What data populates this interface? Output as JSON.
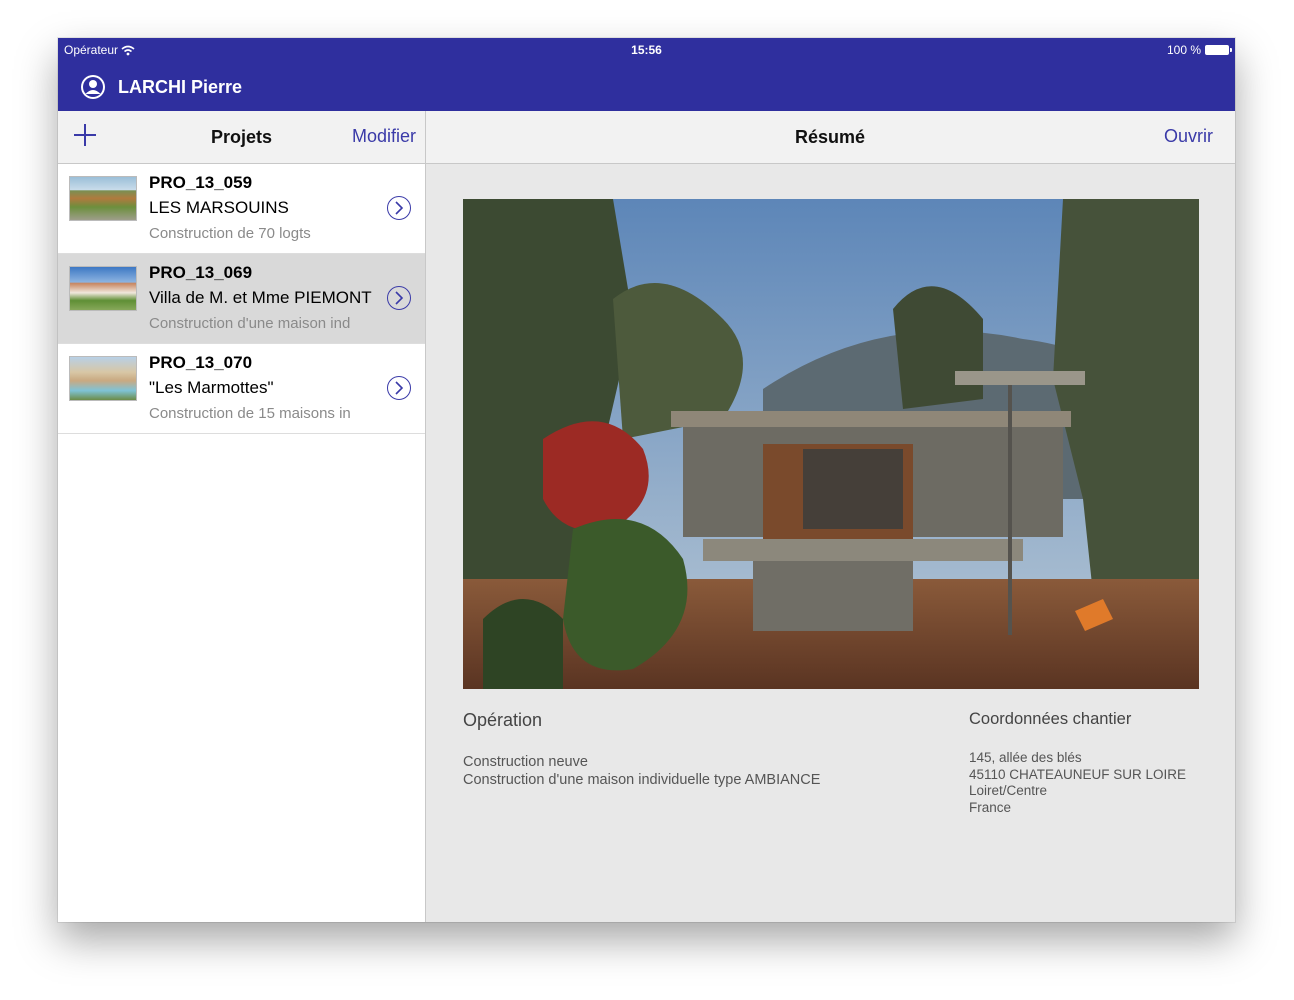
{
  "status_bar": {
    "carrier": "Opérateur",
    "time": "15:56",
    "battery": "100 %"
  },
  "header": {
    "user_name": "LARCHI Pierre"
  },
  "left_nav": {
    "title": "Projets",
    "edit_label": "Modifier"
  },
  "right_nav": {
    "title": "Résumé",
    "open_label": "Ouvrir"
  },
  "projects": [
    {
      "code": "PRO_13_059",
      "name": "LES MARSOUINS",
      "desc": "Construction de 70 logts"
    },
    {
      "code": "PRO_13_069",
      "name": "Villa de M. et Mme PIEMONT",
      "desc": "Construction d'une maison ind"
    },
    {
      "code": "PRO_13_070",
      "name": " \"Les Marmottes\"",
      "desc": "Construction de 15 maisons in"
    }
  ],
  "selected_project_index": 1,
  "operation": {
    "title": "Opération",
    "lines": [
      "Construction neuve",
      "Construction d'une maison individuelle type AMBIANCE"
    ]
  },
  "site": {
    "title": "Coordonnées chantier",
    "lines": [
      "145, allée des blés",
      "45110 CHATEAUNEUF SUR LOIRE",
      "Loiret/Centre",
      "France"
    ]
  },
  "colors": {
    "header_bg": "#2f2f9e",
    "accent": "#3a3aa8",
    "selected_row": "#d9d9d9"
  }
}
